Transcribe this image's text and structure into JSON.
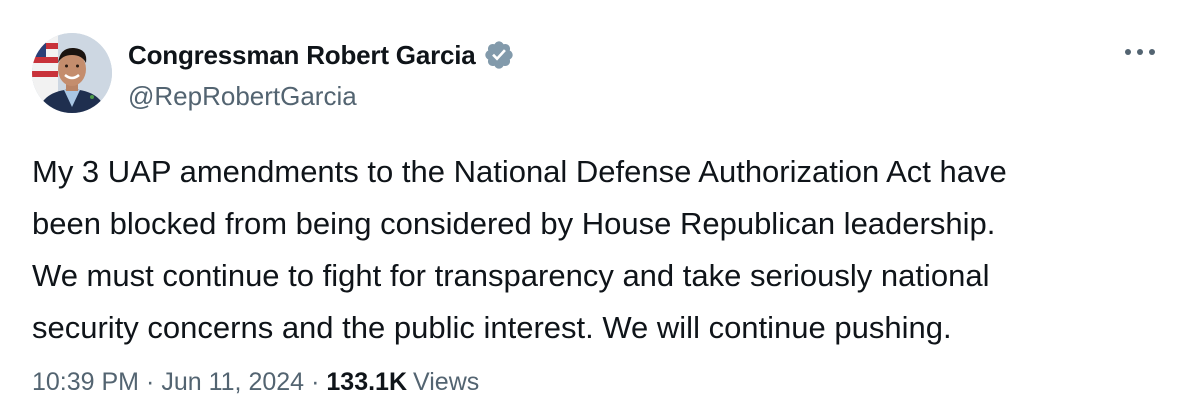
{
  "author": {
    "display_name": "Congressman Robert Garcia",
    "handle": "@RepRobertGarcia",
    "verified_badge_color": "#829aab"
  },
  "tweet": {
    "text": "My 3 UAP amendments to the National Defense Authorization Act have\nbeen blocked from being considered by House Republican leadership.\nWe must continue to fight for transparency and take seriously national\nsecurity concerns and the public interest. We will continue pushing.",
    "time": "10:39 PM",
    "separator": "·",
    "date": "Jun 11, 2024",
    "views_count": "133.1K",
    "views_label": "Views"
  },
  "icons": {
    "more": "more-horizontal-icon",
    "verified": "verified-badge-icon"
  },
  "colors": {
    "text_primary": "#0f1419",
    "text_secondary": "#536471",
    "background": "#ffffff"
  }
}
